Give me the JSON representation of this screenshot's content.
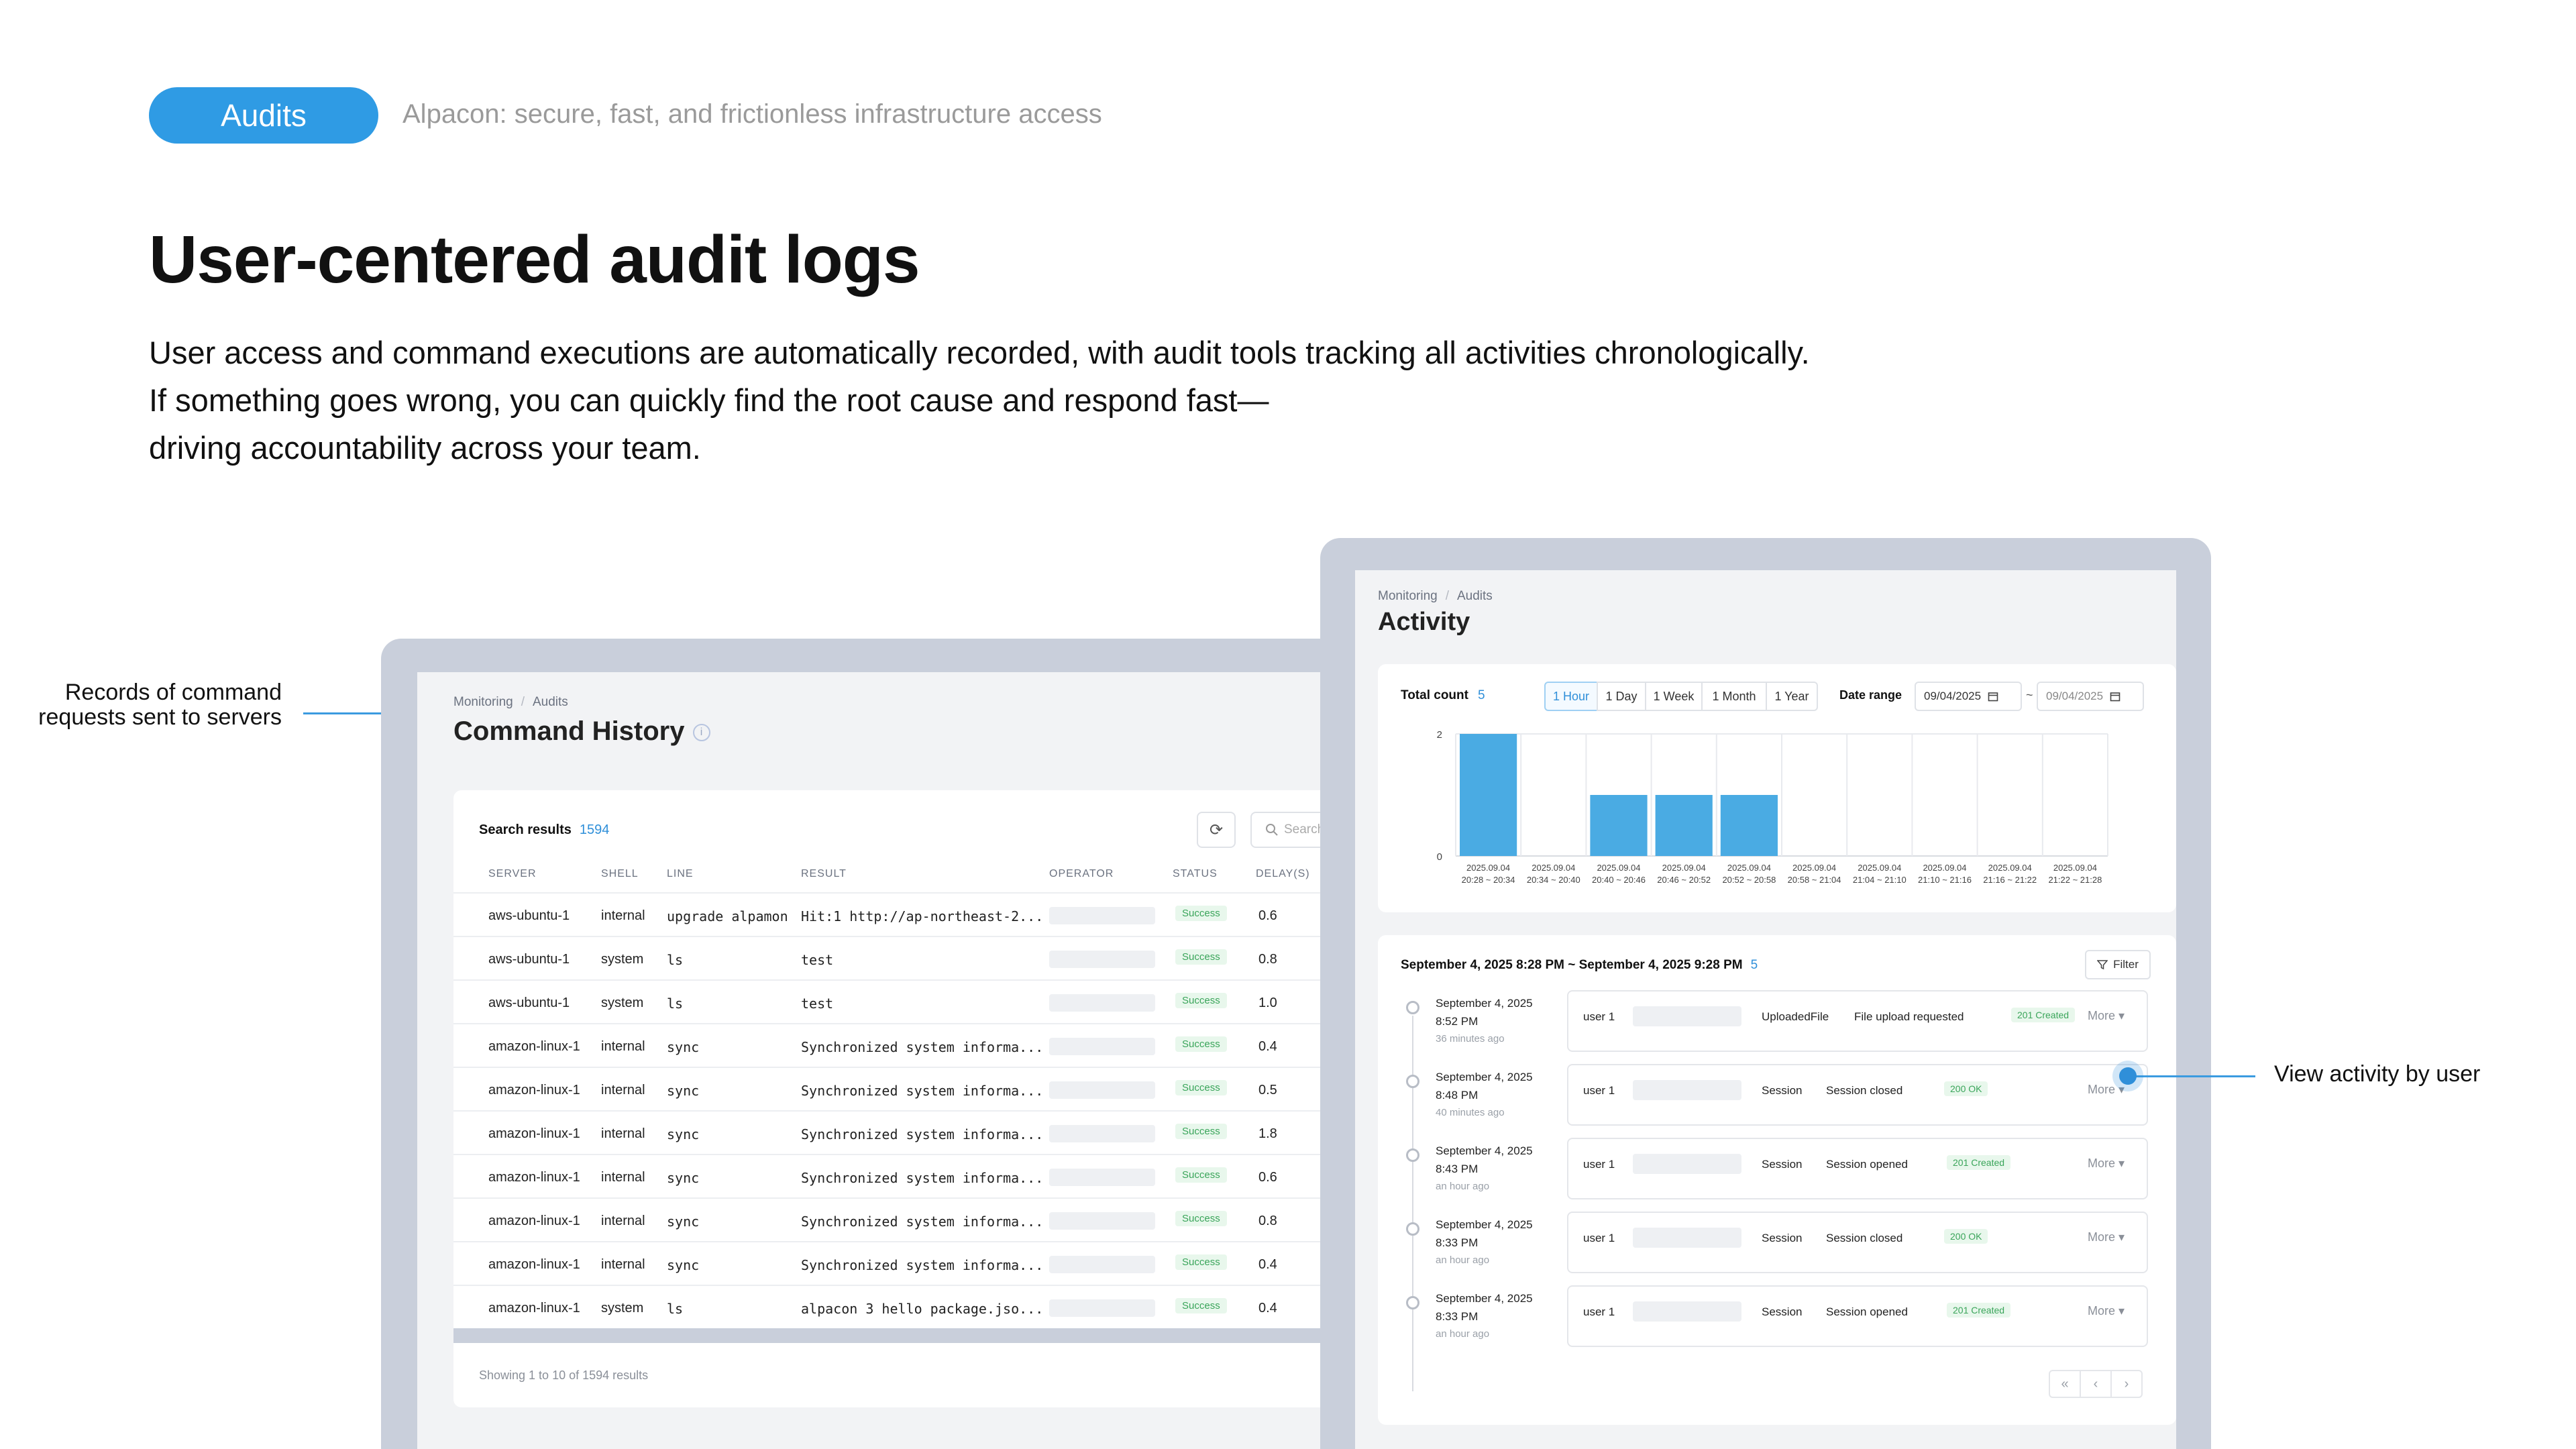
{
  "hero": {
    "pill": "Audits",
    "tagline": "Alpacon: secure, fast, and frictionless infrastructure access",
    "title": "User-centered audit logs",
    "desc": [
      "User access and command executions are automatically recorded, with audit tools tracking all activities chronologically.",
      "If something goes wrong, you can quickly find the root cause and respond fast—",
      "driving accountability across your team."
    ]
  },
  "callouts": {
    "left": [
      "Records of command",
      "requests sent to servers"
    ],
    "right": "View activity by user"
  },
  "command_history": {
    "breadcrumb": [
      "Monitoring",
      "Audits"
    ],
    "title": "Command History",
    "info_icon": "i",
    "search_results_label": "Search results",
    "search_results_count": "1594",
    "refresh_icon": "⟳",
    "search_placeholder": "Search",
    "columns": [
      "SERVER",
      "SHELL",
      "LINE",
      "RESULT",
      "OPERATOR",
      "STATUS",
      "DELAY(S)"
    ],
    "rows": [
      {
        "server": "aws-ubuntu-1",
        "shell": "internal",
        "line": "upgrade alpamon",
        "result": "Hit:1 http://ap-northeast-2...",
        "status": "Success",
        "delay": "0.6"
      },
      {
        "server": "aws-ubuntu-1",
        "shell": "system",
        "line": "ls",
        "result": "test",
        "status": "Success",
        "delay": "0.8"
      },
      {
        "server": "aws-ubuntu-1",
        "shell": "system",
        "line": "ls",
        "result": "test",
        "status": "Success",
        "delay": "1.0"
      },
      {
        "server": "amazon-linux-1",
        "shell": "internal",
        "line": "sync",
        "result": "Synchronized system informa...",
        "status": "Success",
        "delay": "0.4"
      },
      {
        "server": "amazon-linux-1",
        "shell": "internal",
        "line": "sync",
        "result": "Synchronized system informa...",
        "status": "Success",
        "delay": "0.5"
      },
      {
        "server": "amazon-linux-1",
        "shell": "internal",
        "line": "sync",
        "result": "Synchronized system informa...",
        "status": "Success",
        "delay": "1.8"
      },
      {
        "server": "amazon-linux-1",
        "shell": "internal",
        "line": "sync",
        "result": "Synchronized system informa...",
        "status": "Success",
        "delay": "0.6"
      },
      {
        "server": "amazon-linux-1",
        "shell": "internal",
        "line": "sync",
        "result": "Synchronized system informa...",
        "status": "Success",
        "delay": "0.8"
      },
      {
        "server": "amazon-linux-1",
        "shell": "internal",
        "line": "sync",
        "result": "Synchronized system informa...",
        "status": "Success",
        "delay": "0.4"
      },
      {
        "server": "amazon-linux-1",
        "shell": "system",
        "line": "ls",
        "result": "alpacon 3 hello package.jso...",
        "status": "Success",
        "delay": "0.4"
      }
    ],
    "showing": "Showing 1 to 10 of 1594 results"
  },
  "activity": {
    "breadcrumb": [
      "Monitoring",
      "Audits"
    ],
    "title": "Activity",
    "total_count_label": "Total count",
    "total_count": "5",
    "tabs": [
      "1 Hour",
      "1 Day",
      "1 Week",
      "1 Month",
      "1 Year"
    ],
    "active_tab": "1 Hour",
    "date_range_label": "Date range",
    "date_from": "09/04/2025",
    "date_to": "09/04/2025",
    "range_title": "September 4, 2025 8:28 PM ~ September 4, 2025 9:28 PM",
    "range_count": "5",
    "filter_label": "Filter",
    "more_label": "More",
    "events": [
      {
        "date": "September 4, 2025",
        "time": "8:52 PM",
        "ago": "36 minutes ago",
        "user": "user 1",
        "type": "UploadedFile",
        "action": "File upload requested",
        "badge": "201 Created"
      },
      {
        "date": "September 4, 2025",
        "time": "8:48 PM",
        "ago": "40 minutes ago",
        "user": "user 1",
        "type": "Session",
        "action": "Session closed",
        "badge": "200 OK"
      },
      {
        "date": "September 4, 2025",
        "time": "8:43 PM",
        "ago": "an hour ago",
        "user": "user 1",
        "type": "Session",
        "action": "Session opened",
        "badge": "201 Created"
      },
      {
        "date": "September 4, 2025",
        "time": "8:33 PM",
        "ago": "an hour ago",
        "user": "user 1",
        "type": "Session",
        "action": "Session closed",
        "badge": "200 OK"
      },
      {
        "date": "September 4, 2025",
        "time": "8:33 PM",
        "ago": "an hour ago",
        "user": "user 1",
        "type": "Session",
        "action": "Session opened",
        "badge": "201 Created"
      }
    ],
    "pagination": [
      "«",
      "‹",
      "›"
    ]
  },
  "chart_data": {
    "type": "bar",
    "categories": [
      [
        "2025.09.04",
        "20:28 ~ 20:34"
      ],
      [
        "2025.09.04",
        "20:34 ~ 20:40"
      ],
      [
        "2025.09.04",
        "20:40 ~ 20:46"
      ],
      [
        "2025.09.04",
        "20:46 ~ 20:52"
      ],
      [
        "2025.09.04",
        "20:52 ~ 20:58"
      ],
      [
        "2025.09.04",
        "20:58 ~ 21:04"
      ],
      [
        "2025.09.04",
        "21:04 ~ 21:10"
      ],
      [
        "2025.09.04",
        "21:10 ~ 21:16"
      ],
      [
        "2025.09.04",
        "21:16 ~ 21:22"
      ],
      [
        "2025.09.04",
        "21:22 ~ 21:28"
      ]
    ],
    "values": [
      2,
      0,
      1,
      1,
      1,
      0,
      0,
      0,
      0,
      0
    ],
    "yticks": [
      0,
      2
    ],
    "ylim": [
      0,
      2
    ],
    "bar_color": "#4aabe3",
    "grid": true
  }
}
